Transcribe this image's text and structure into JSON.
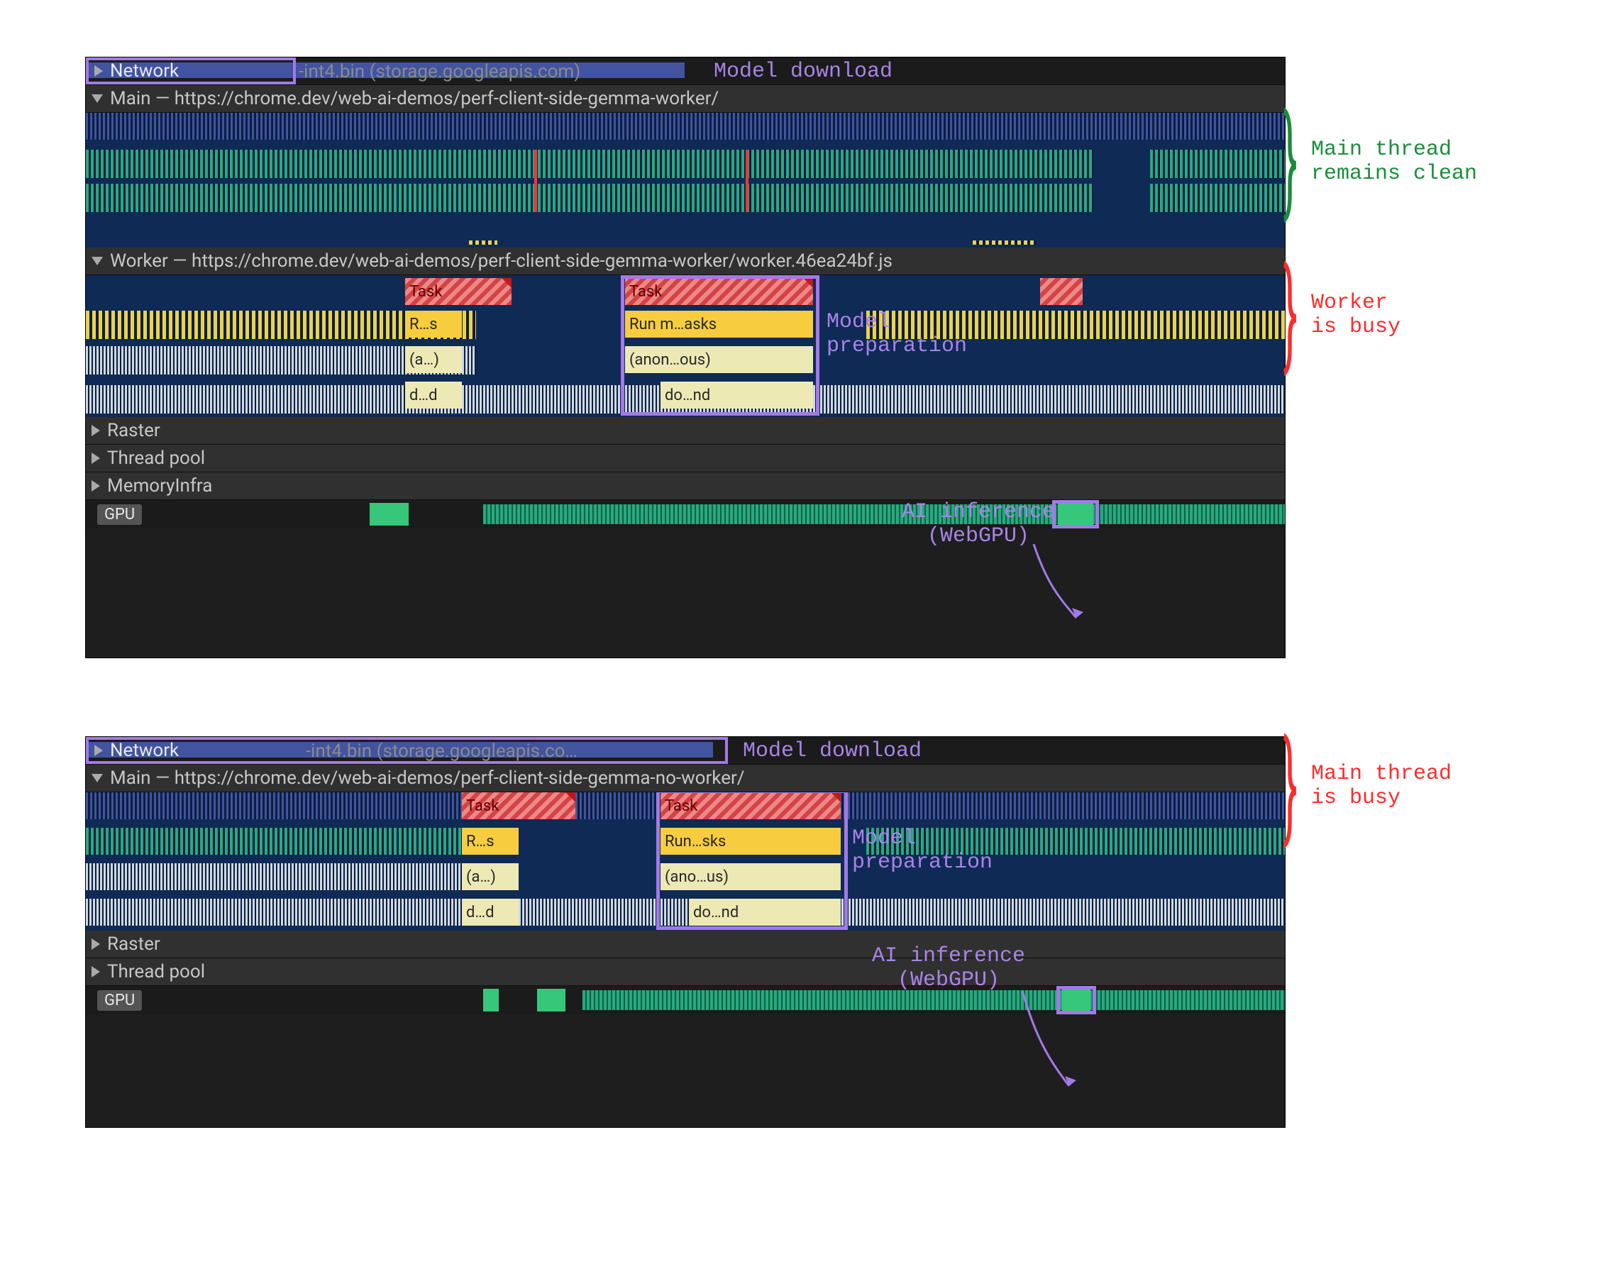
{
  "accent_purple": "#a27ae6",
  "accent_green": "#1a8d3a",
  "accent_red": "#ff2b2b",
  "panel1": {
    "network": {
      "label": "Network",
      "file": "-int4.bin (storage.googleapis.com)"
    },
    "main_hdr": "Main — https://chrome.dev/web-ai-demos/perf-client-side-gemma-worker/",
    "worker_hdr": "Worker — https://chrome.dev/web-ai-demos/perf-client-side-gemma-worker/worker.46ea24bf.js",
    "raster": "Raster",
    "thread_pool": "Thread pool",
    "memory_infra": "MemoryInfra",
    "gpu": "GPU",
    "task_a": "Task",
    "task_b": "Task",
    "cells": {
      "rs": "R…s",
      "runm": "Run m…asks",
      "a": "(a…)",
      "anon": "(anon…ous)",
      "dd": "d…d",
      "dond": "do…nd"
    }
  },
  "panel2": {
    "network": {
      "label": "Network",
      "file": "-int4.bin (storage.googleapis.co…"
    },
    "main_hdr": "Main — https://chrome.dev/web-ai-demos/perf-client-side-gemma-no-worker/",
    "raster": "Raster",
    "thread_pool": "Thread pool",
    "gpu": "GPU",
    "task_a": "Task",
    "task_b": "Task",
    "cells": {
      "rs": "R…s",
      "runsks": "Run…sks",
      "a": "(a…)",
      "anous": "(ano…us)",
      "dd": "d…d",
      "dond": "do…nd"
    }
  },
  "annotations": {
    "model_download": "Model download",
    "main_clean_l1": "Main thread",
    "main_clean_l2": "remains clean",
    "worker_busy_l1": "Worker",
    "worker_busy_l2": "is busy",
    "model_prep_l1": "Model",
    "model_prep_l2": "preparation",
    "ai_inf_l1": "AI inference",
    "ai_inf_l2": "(WebGPU)",
    "main_busy_l1": "Main thread",
    "main_busy_l2": "is busy"
  }
}
